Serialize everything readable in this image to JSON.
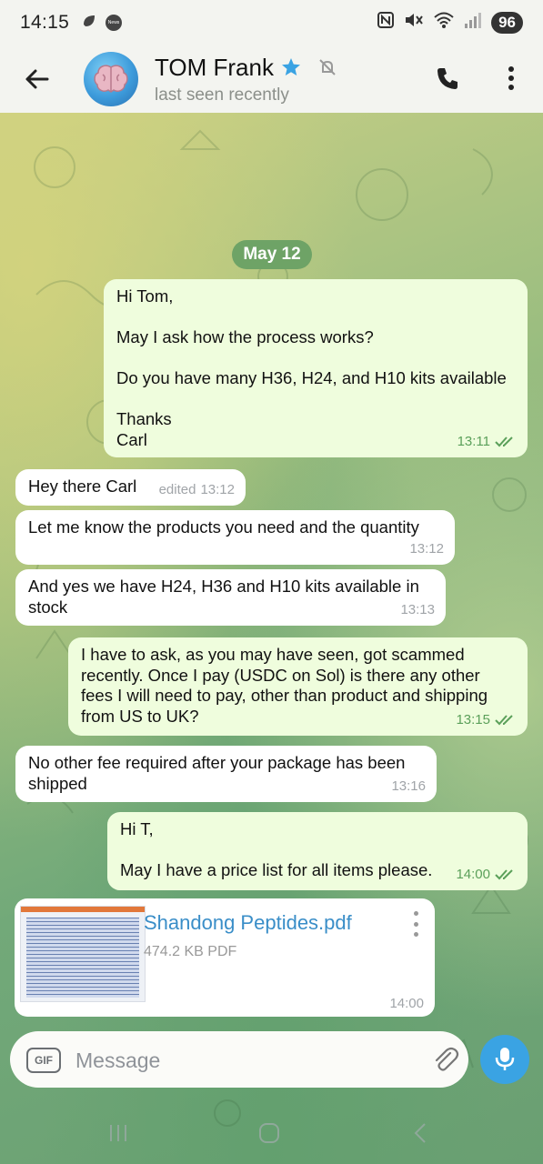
{
  "status_bar": {
    "time": "14:15",
    "news_badge": "News",
    "battery": "96"
  },
  "header": {
    "contact_name": "TOM Frank",
    "last_seen": "last seen recently"
  },
  "date_chip": "May 12",
  "messages": [
    {
      "direction": "out",
      "text": "Hi Tom,\n\nMay I ask how the process works?\n\nDo you have many H36, H24, and H10 kits available\n\nThanks\nCarl",
      "time": "13:11",
      "status": "read"
    },
    {
      "direction": "in",
      "text": "Hey there Carl",
      "edited_label": "edited",
      "time": "13:12"
    },
    {
      "direction": "in",
      "text": "Let me know the products you need and the quantity",
      "time": "13:12"
    },
    {
      "direction": "in",
      "text": "And yes we have H24, H36 and H10 kits available in\nstock",
      "time": "13:13"
    },
    {
      "direction": "out",
      "text": "I have to ask, as you may have seen, got scammed\nrecently. Once I pay (USDC on Sol) is there any other\nfees I will need to pay, other than product and shipping\nfrom US to UK?",
      "time": "13:15",
      "status": "read"
    },
    {
      "direction": "in",
      "text": "No other fee required after your package has been\nshipped",
      "time": "13:16"
    },
    {
      "direction": "out",
      "text": "Hi T,\n\nMay I have a price list for all items please.",
      "time": "14:00",
      "status": "read"
    }
  ],
  "file_message": {
    "file_name": "Shandong Peptides.pdf",
    "file_size": "474.2 KB PDF",
    "time": "14:00"
  },
  "input": {
    "gif_label": "GIF",
    "placeholder": "Message"
  },
  "colors": {
    "accent_blue": "#3aa3e3",
    "outgoing_bubble": "#effddd",
    "incoming_bubble": "#ffffff",
    "check_green": "#5ba05a",
    "date_chip": "#6ea366"
  }
}
